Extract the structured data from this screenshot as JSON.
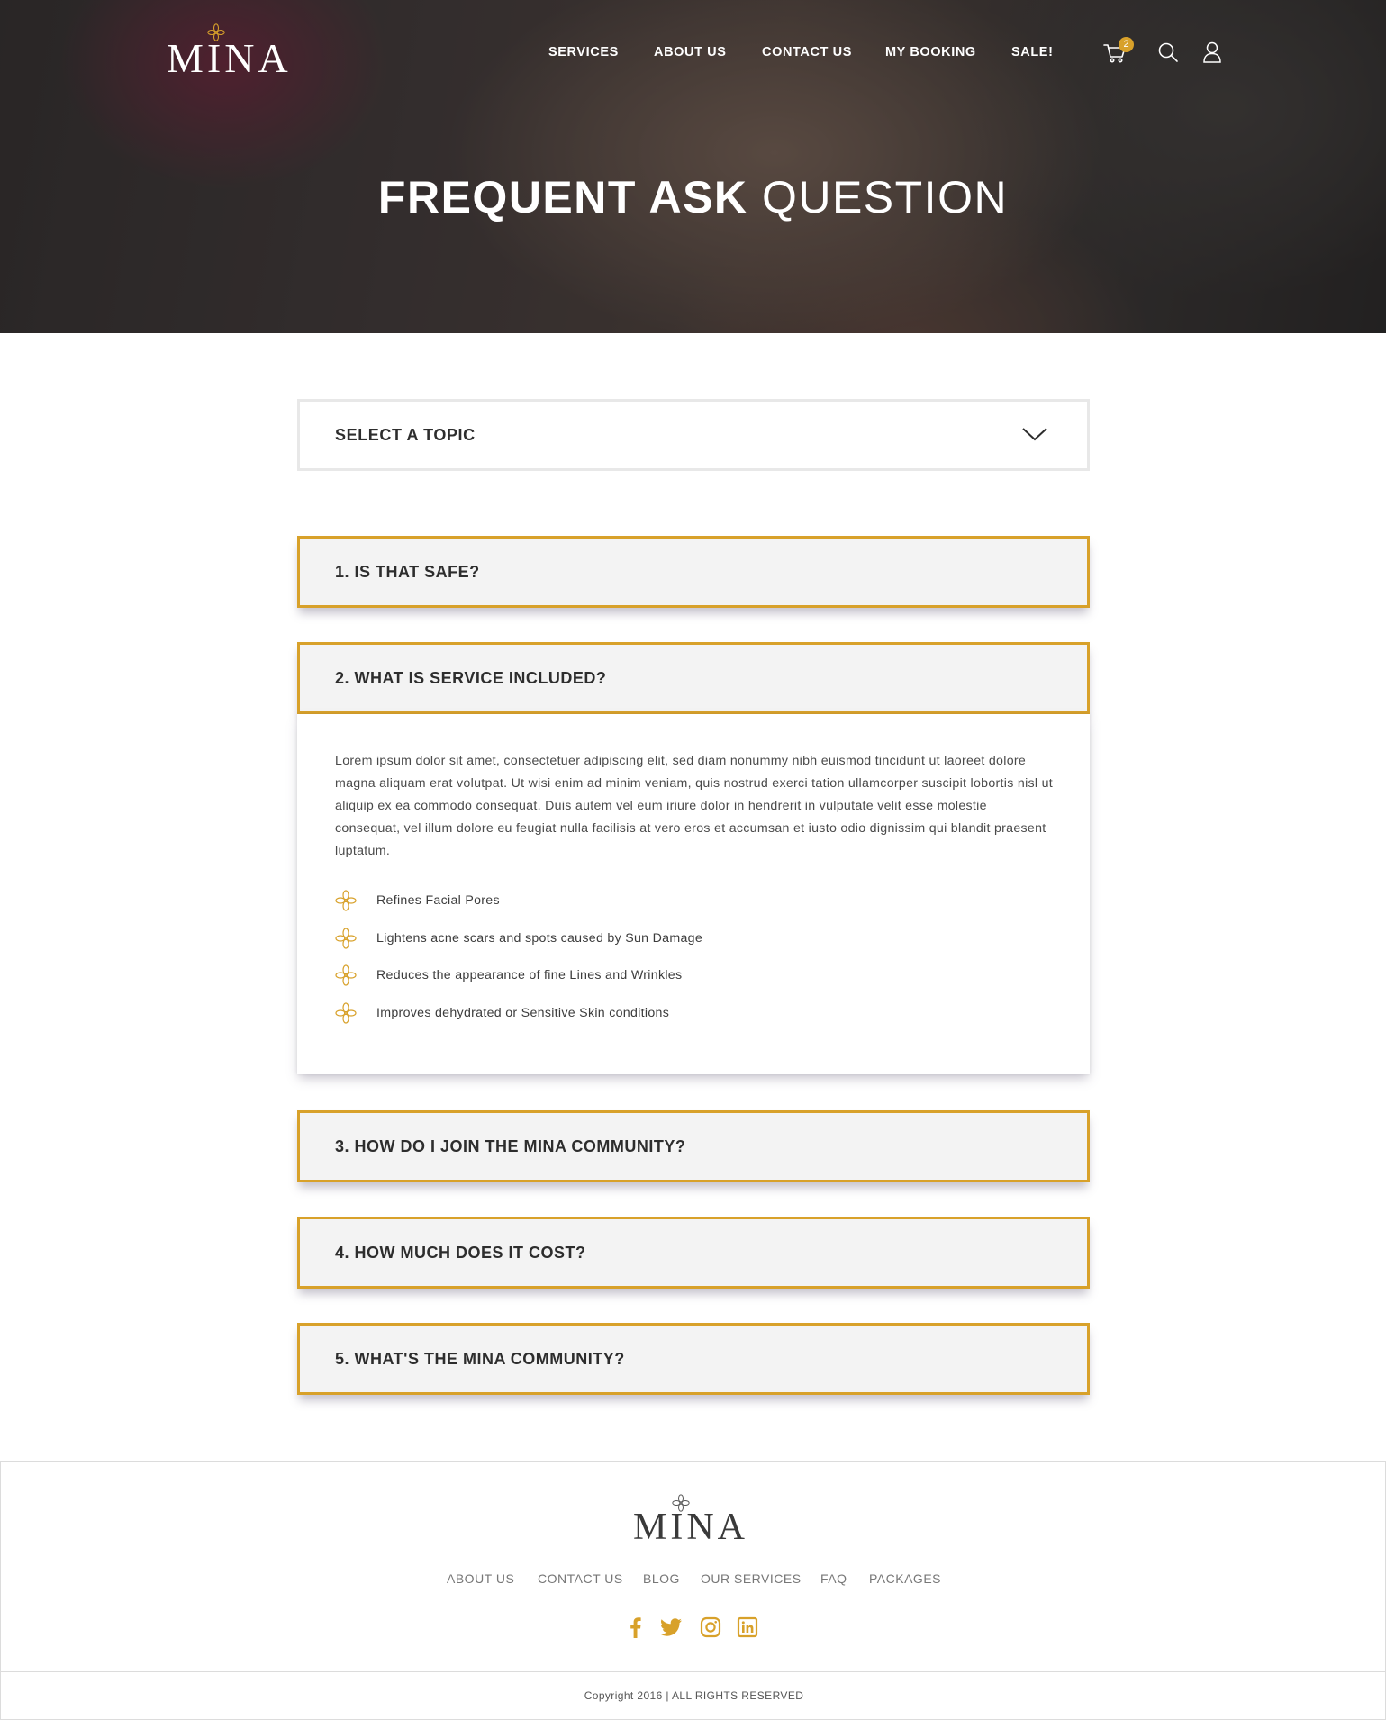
{
  "brand": {
    "name": "MINA",
    "accent": "#d8a12a",
    "logo_icon": "flower-icon"
  },
  "nav": {
    "items": [
      "SERVICES",
      "ABOUT US",
      "CONTACT US",
      "MY BOOKING",
      "SALE!"
    ],
    "cart_count": "2",
    "icons": [
      "cart-icon",
      "search-icon",
      "user-icon"
    ]
  },
  "hero": {
    "title_bold": "FREQUENT ASK",
    "title_light": "QUESTION"
  },
  "topic_select": {
    "label": "SELECT A TOPIC",
    "icon": "chevron-down-icon"
  },
  "faq": {
    "items": [
      {
        "question": "1. IS THAT SAFE?"
      },
      {
        "question": "2. WHAT IS SERVICE INCLUDED?"
      },
      {
        "question": "3. HOW DO I JOIN THE MINA COMMUNITY?"
      },
      {
        "question": "4. HOW MUCH DOES IT COST?"
      },
      {
        "question": "5. WHAT'S THE MINA COMMUNITY?"
      }
    ],
    "open_answer": {
      "paragraph": "Lorem ipsum dolor sit amet, consectetuer adipiscing elit, sed diam nonummy nibh euismod tincidunt ut laoreet dolore magna aliquam erat volutpat. Ut wisi enim ad minim veniam, quis nostrud exerci tation ullamcorper suscipit lobortis nisl ut aliquip ex ea commodo consequat. Duis autem vel eum iriure dolor in hendrerit in vulputate velit esse molestie consequat, vel illum dolore eu feugiat nulla facilisis at vero eros et accumsan et iusto odio dignissim qui blandit praesent luptatum.",
      "bullets": [
        "Refines Facial Pores",
        "Lightens acne scars and spots caused by Sun Damage",
        "Reduces the appearance of fine Lines and Wrinkles",
        "Improves dehydrated or Sensitive Skin conditions"
      ]
    }
  },
  "footer": {
    "links": [
      "ABOUT US",
      "CONTACT US",
      "BLOG",
      "OUR SERVICES",
      "FAQ",
      "PACKAGES"
    ],
    "social": [
      "facebook-icon",
      "twitter-icon",
      "instagram-icon",
      "linkedin-icon"
    ],
    "copyright": "Copyright 2016 | ALL RIGHTS RESERVED"
  }
}
